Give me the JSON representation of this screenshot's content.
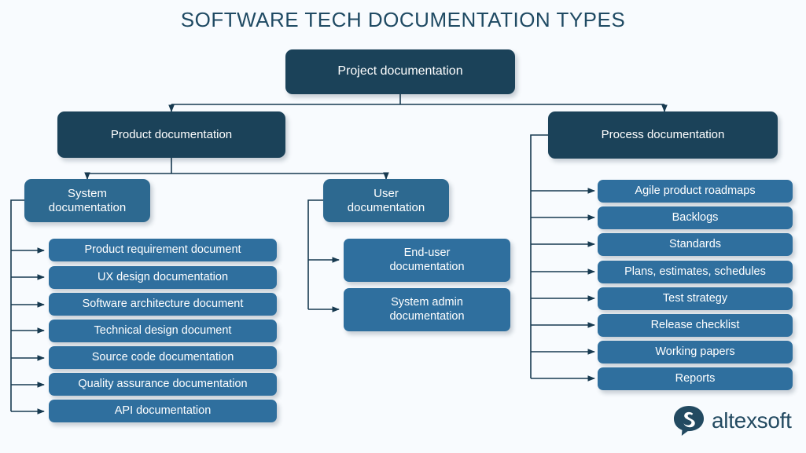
{
  "title": "SOFTWARE TECH DOCUMENTATION TYPES",
  "colors": {
    "background": "#f8fbfe",
    "dark_node": "#1b4259",
    "mid_node": "#2d6990",
    "leaf_node": "#2f6f9e",
    "connector": "#173a50",
    "title_text": "#1f4a63",
    "logo_text": "#234a61"
  },
  "root": {
    "label": "Project documentation"
  },
  "branches": [
    {
      "label": "Product documentation",
      "children": [
        {
          "label": "System\ndocumentation",
          "items": [
            "Product requirement document",
            "UX design documentation",
            "Software architecture document",
            "Technical design document",
            "Source code documentation",
            "Quality assurance documentation",
            "API documentation"
          ]
        },
        {
          "label": "User\ndocumentation",
          "items": [
            "End-user\ndocumentation",
            "System admin\ndocumentation"
          ]
        }
      ]
    },
    {
      "label": "Process documentation",
      "items": [
        "Agile product roadmaps",
        "Backlogs",
        "Standards",
        "Plans, estimates, schedules",
        "Test strategy",
        "Release checklist",
        "Working papers",
        "Reports"
      ]
    }
  ],
  "logo": {
    "name": "altexsoft-logo",
    "text": "altexsoft",
    "mark": "speech-bubble-s-icon"
  }
}
